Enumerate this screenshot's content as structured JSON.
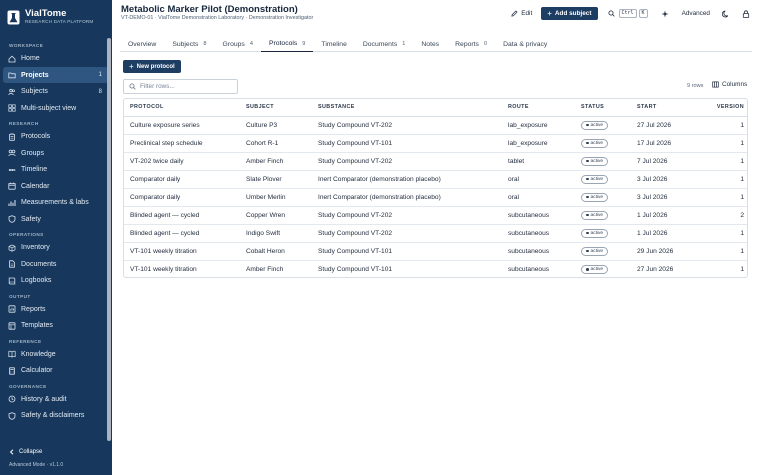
{
  "app": {
    "name": "VialTome",
    "tagline": "RESEARCH DATA PLATFORM"
  },
  "sidebar": {
    "sections": [
      {
        "title": "WORKSPACE",
        "items": [
          {
            "label": "Home",
            "icon": "home-icon"
          },
          {
            "label": "Projects",
            "icon": "folder-icon",
            "count": "1",
            "active": true
          },
          {
            "label": "Subjects",
            "icon": "users-icon",
            "count": "8"
          },
          {
            "label": "Multi-subject view",
            "icon": "grid-icon"
          }
        ]
      },
      {
        "title": "RESEARCH",
        "items": [
          {
            "label": "Protocols",
            "icon": "clipboard-icon"
          },
          {
            "label": "Groups",
            "icon": "groups-icon"
          },
          {
            "label": "Timeline",
            "icon": "timeline-icon"
          },
          {
            "label": "Calendar",
            "icon": "calendar-icon"
          },
          {
            "label": "Measurements & labs",
            "icon": "chart-icon"
          },
          {
            "label": "Safety",
            "icon": "shield-icon"
          }
        ]
      },
      {
        "title": "OPERATIONS",
        "items": [
          {
            "label": "Inventory",
            "icon": "box-icon"
          },
          {
            "label": "Documents",
            "icon": "document-icon"
          },
          {
            "label": "Logbooks",
            "icon": "book-icon"
          }
        ]
      },
      {
        "title": "OUTPUT",
        "items": [
          {
            "label": "Reports",
            "icon": "report-icon"
          },
          {
            "label": "Templates",
            "icon": "template-icon"
          }
        ]
      },
      {
        "title": "REFERENCE",
        "items": [
          {
            "label": "Knowledge",
            "icon": "knowledge-icon"
          },
          {
            "label": "Calculator",
            "icon": "calculator-icon"
          }
        ]
      },
      {
        "title": "GOVERNANCE",
        "items": [
          {
            "label": "History & audit",
            "icon": "history-icon"
          },
          {
            "label": "Safety & disclaimers",
            "icon": "shield-icon"
          }
        ]
      }
    ],
    "collapse_label": "Collapse",
    "mode_label": "Advanced Mode · v1.1.0"
  },
  "header": {
    "title": "Metabolic Marker Pilot (Demonstration)",
    "subtitle": "VT-DEMO-01 · VialTome Demonstration Laboratory · Demonstration Investigator",
    "edit_label": "Edit",
    "add_subject_label": "Add subject",
    "kbd_ctrl": "Ctrl",
    "kbd_k": "K",
    "advanced_label": "Advanced"
  },
  "tabs": [
    {
      "label": "Overview"
    },
    {
      "label": "Subjects",
      "count": "8"
    },
    {
      "label": "Groups",
      "count": "4"
    },
    {
      "label": "Protocols",
      "count": "9",
      "active": true
    },
    {
      "label": "Timeline"
    },
    {
      "label": "Documents",
      "count": "1"
    },
    {
      "label": "Notes"
    },
    {
      "label": "Reports",
      "count": "0"
    },
    {
      "label": "Data & privacy"
    }
  ],
  "toolbar": {
    "new_protocol_label": "New protocol",
    "filter_placeholder": "Filter rows...",
    "rows_count": "9 rows",
    "columns_label": "Columns"
  },
  "table": {
    "columns": [
      "PROTOCOL",
      "SUBJECT",
      "SUBSTANCE",
      "ROUTE",
      "STATUS",
      "START",
      "VERSION"
    ],
    "rows": [
      {
        "protocol": "Culture exposure series",
        "subject": "Culture P3",
        "substance": "Study Compound VT-202",
        "route": "lab_exposure",
        "status": "active",
        "start": "27 Jul 2026",
        "version": "1"
      },
      {
        "protocol": "Preclinical step schedule",
        "subject": "Cohort R-1",
        "substance": "Study Compound VT-101",
        "route": "lab_exposure",
        "status": "active",
        "start": "17 Jul 2026",
        "version": "1"
      },
      {
        "protocol": "VT-202 twice daily",
        "subject": "Amber Finch",
        "substance": "Study Compound VT-202",
        "route": "tablet",
        "status": "active",
        "start": "7 Jul 2026",
        "version": "1"
      },
      {
        "protocol": "Comparator daily",
        "subject": "Slate Plover",
        "substance": "Inert Comparator (demonstration placebo)",
        "route": "oral",
        "status": "active",
        "start": "3 Jul 2026",
        "version": "1"
      },
      {
        "protocol": "Comparator daily",
        "subject": "Umber Merlin",
        "substance": "Inert Comparator (demonstration placebo)",
        "route": "oral",
        "status": "active",
        "start": "3 Jul 2026",
        "version": "1"
      },
      {
        "protocol": "Blinded agent — cycled",
        "subject": "Copper Wren",
        "substance": "Study Compound VT-202",
        "route": "subcutaneous",
        "status": "active",
        "start": "1 Jul 2026",
        "version": "2"
      },
      {
        "protocol": "Blinded agent — cycled",
        "subject": "Indigo Swift",
        "substance": "Study Compound VT-202",
        "route": "subcutaneous",
        "status": "active",
        "start": "1 Jul 2026",
        "version": "1"
      },
      {
        "protocol": "VT-101 weekly titration",
        "subject": "Cobalt Heron",
        "substance": "Study Compound VT-101",
        "route": "subcutaneous",
        "status": "active",
        "start": "29 Jun 2026",
        "version": "1"
      },
      {
        "protocol": "VT-101 weekly titration",
        "subject": "Amber Finch",
        "substance": "Study Compound VT-101",
        "route": "subcutaneous",
        "status": "active",
        "start": "27 Jun 2026",
        "version": "1"
      }
    ]
  },
  "colors": {
    "sidebar_bg": "#17385c",
    "sidebar_active": "#2e5680",
    "primary_button": "#1d3d63",
    "text": "#1f2a3c"
  }
}
